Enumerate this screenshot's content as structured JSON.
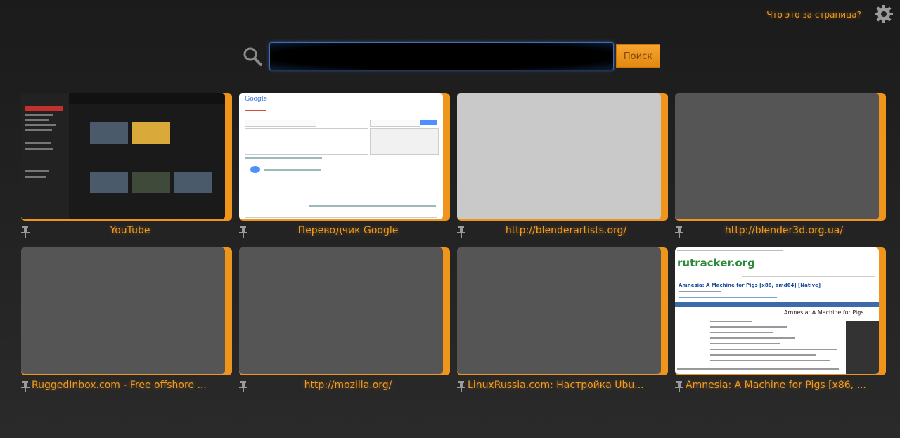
{
  "header": {
    "help_link": "Что это за страница?"
  },
  "search": {
    "value": "",
    "placeholder": "",
    "button_label": "Поиск"
  },
  "thumbnail_texts": {
    "google_logo": "Google",
    "rutracker_logo": "rutracker.org",
    "rutracker_heading": "Amnesia: A Machine for Pigs [x86, amd64] [Native]",
    "rutracker_subheading": "Amnesia: A Machine for Pigs"
  },
  "tiles": [
    {
      "title": "YouTube",
      "thumbnail": "youtube"
    },
    {
      "title": "Переводчик Google",
      "thumbnail": "google-translate"
    },
    {
      "title": "http://blenderartists.org/",
      "thumbnail": "blank"
    },
    {
      "title": "http://blender3d.org.ua/",
      "thumbnail": "blank"
    },
    {
      "title": "RuggedInbox.com - Free offshore ...",
      "thumbnail": "blank"
    },
    {
      "title": "http://mozilla.org/",
      "thumbnail": "blank"
    },
    {
      "title": "LinuxRussia.com: Настройка Ubu...",
      "thumbnail": "blank"
    },
    {
      "title": "Amnesia: A Machine for Pigs [x86, ...",
      "thumbnail": "rutracker"
    }
  ],
  "colors": {
    "accent": "#f19a1e",
    "tile_border": "#f0951c",
    "placeholder_thumb": "#555555",
    "search_glow": "#3e6fb0"
  },
  "icons": {
    "search": "search-icon",
    "settings": "gear-icon",
    "pin": "pin-icon"
  }
}
